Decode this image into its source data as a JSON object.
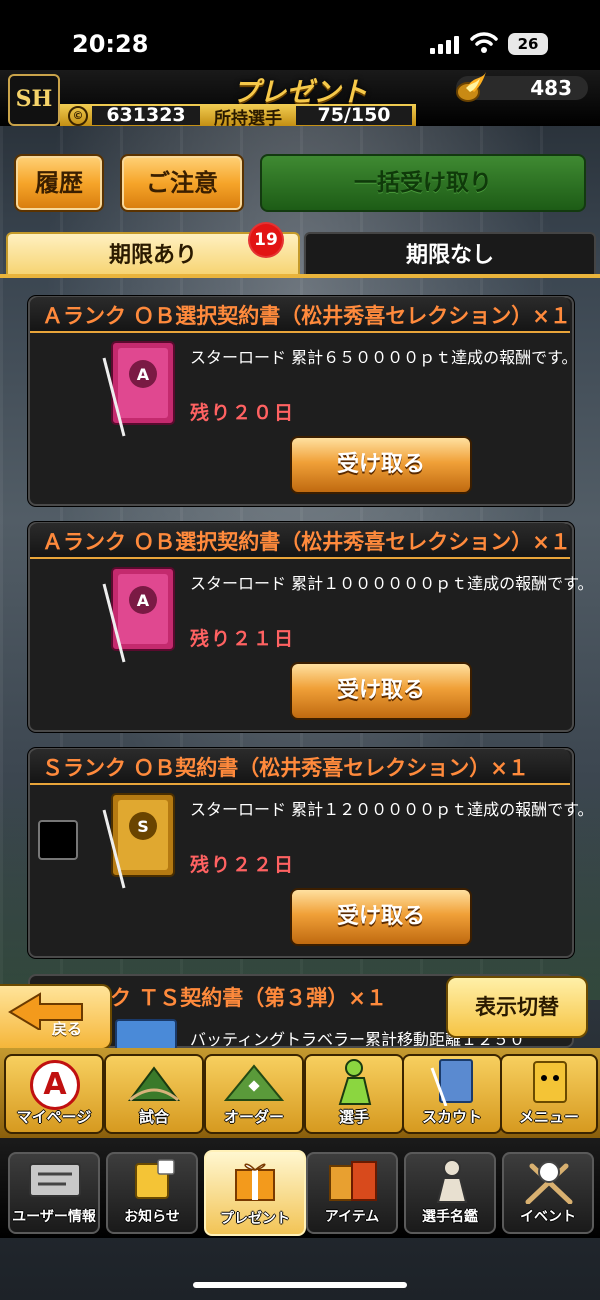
{
  "status_bar": {
    "time": "20:28",
    "battery": "26"
  },
  "header": {
    "title": "プレゼント",
    "coins": "483",
    "money_symbol": "©",
    "money": "631323",
    "players_label": "所持選手",
    "players": "75/150",
    "logo_text": "SH"
  },
  "actions": {
    "history": "履歴",
    "notice": "ご注意",
    "bulk_receive": "一括受け取り"
  },
  "tabs": {
    "limited": "期限あり",
    "unlimited": "期限なし",
    "badge": "19"
  },
  "cards": [
    {
      "title": "Ａランク ＯＢ選択契約書（松井秀喜セレクション）×１",
      "description": "スターロード 累計６５００００ｐｔ達成の報酬です。",
      "remaining": "残り２０日",
      "button": "受け取る",
      "rank_letter": "A",
      "color": "#d0307a"
    },
    {
      "title": "Ａランク ＯＢ選択契約書（松井秀喜セレクション）×１",
      "description": "スターロード 累計１００００００ｐｔ達成の報酬です。",
      "remaining": "残り２１日",
      "button": "受け取る",
      "rank_letter": "A",
      "color": "#d0307a"
    },
    {
      "title": "Ｓランク ＯＢ契約書（松井秀喜セレクション）×１",
      "description": "スターロード 累計１２０００００ｐｔ達成の報酬です。",
      "remaining": "残り２２日",
      "button": "受け取る",
      "rank_letter": "S",
      "color": "#c98a1c"
    }
  ],
  "partial_card": {
    "title": "ク ＴＳ契約書（第３弾）×１",
    "description": "バッティングトラベラー累計移動距離１２５０"
  },
  "back_label": "戻る",
  "toggle_display": "表示切替",
  "nav_top": [
    {
      "label": "マイページ",
      "icon": "A"
    },
    {
      "label": "試合",
      "icon": "stadium"
    },
    {
      "label": "オーダー",
      "icon": "field"
    },
    {
      "label": "選手",
      "icon": "pitcher"
    },
    {
      "label": "スカウト",
      "icon": "contract"
    },
    {
      "label": "メニュー",
      "icon": "menu-box"
    }
  ],
  "nav_bottom": [
    {
      "label": "ユーザー情報",
      "icon": "user-card"
    },
    {
      "label": "お知らせ",
      "icon": "notice-box"
    },
    {
      "label": "プレゼント",
      "icon": "gift"
    },
    {
      "label": "アイテム",
      "icon": "item-box"
    },
    {
      "label": "選手名鑑",
      "icon": "player-book"
    },
    {
      "label": "イベント",
      "icon": "ball-bats"
    }
  ]
}
